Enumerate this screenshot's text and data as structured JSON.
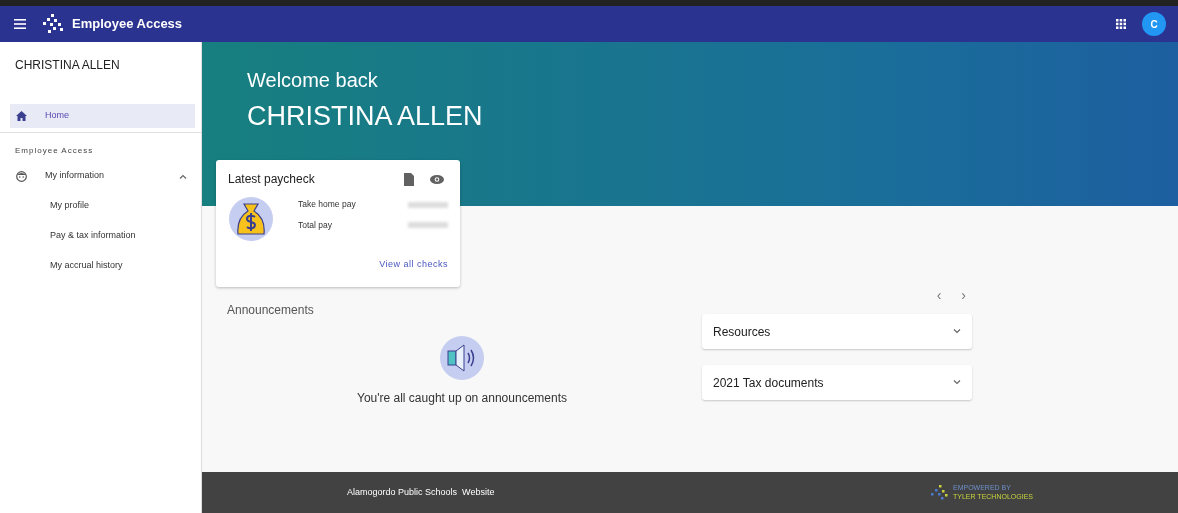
{
  "app_bar": {
    "title": "Employee Access",
    "avatar": "C"
  },
  "sidebar": {
    "user_name": "CHRISTINA ALLEN",
    "items": [
      {
        "label": "Home",
        "selected": true
      }
    ],
    "section": "Employee Access",
    "groups": [
      {
        "label": "My information",
        "expanded": true,
        "children": [
          {
            "label": "My profile"
          },
          {
            "label": "Pay & tax information"
          },
          {
            "label": "My accrual history"
          }
        ]
      }
    ]
  },
  "hero": {
    "greeting": "Welcome back",
    "name": "CHRISTINA ALLEN"
  },
  "paycheck": {
    "title": "Latest paycheck",
    "rows": [
      {
        "label": "Take home pay"
      },
      {
        "label": "Total pay"
      }
    ],
    "link": "View all checks"
  },
  "announcements": {
    "title": "Announcements",
    "prev": "‹",
    "next": "›",
    "empty_text": "You're all caught up on announcements"
  },
  "panels": [
    {
      "label": "Resources",
      "expanded": false
    },
    {
      "label": "2021 Tax documents",
      "expanded": false
    }
  ],
  "footer": {
    "link": "Alamogordo Public Schools  Website",
    "brand_line1": "EMPOWERED BY",
    "brand_line2": "TYLER TECHNOLOGIES"
  }
}
